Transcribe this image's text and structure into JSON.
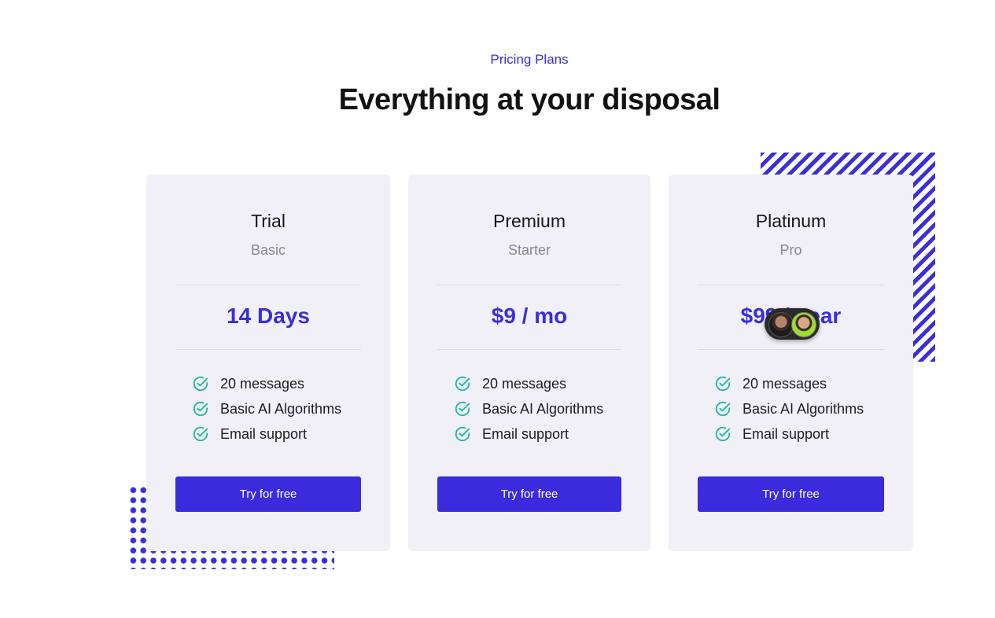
{
  "header": {
    "eyebrow": "Pricing Plans",
    "title": "Everything at your disposal"
  },
  "colors": {
    "accent": "#3a2fd6",
    "check": "#1fb8a4",
    "card_bg": "#f0f0f6"
  },
  "plans": [
    {
      "name": "Trial",
      "subtitle": "Basic",
      "price": "14 Days",
      "features": [
        "20 messages",
        "Basic AI Algorithms",
        "Email support"
      ],
      "cta": "Try for free"
    },
    {
      "name": "Premium",
      "subtitle": "Starter",
      "price": "$9 / mo",
      "features": [
        "20 messages",
        "Basic AI Algorithms",
        "Email support"
      ],
      "cta": "Try for free"
    },
    {
      "name": "Platinum",
      "subtitle": "Pro",
      "price": "$99 / year",
      "features": [
        "20 messages",
        "Basic AI Algorithms",
        "Email support"
      ],
      "cta": "Try for free"
    }
  ],
  "icons": {
    "feature": "check-circle-icon"
  }
}
